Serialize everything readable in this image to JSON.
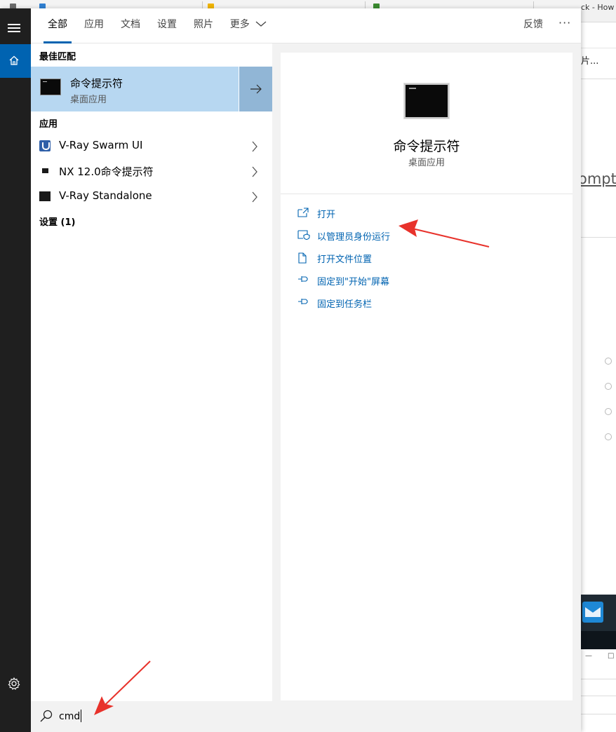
{
  "background_window": {
    "tab_title_fragment": "ck - How t",
    "toolbar_fragment": "片...",
    "text_fragment": "ompt",
    "window_controls": [
      "—",
      "□"
    ]
  },
  "tabs": [
    {
      "label": "全部",
      "active": true
    },
    {
      "label": "应用",
      "active": false
    },
    {
      "label": "文档",
      "active": false
    },
    {
      "label": "设置",
      "active": false
    },
    {
      "label": "照片",
      "active": false
    },
    {
      "label": "更多",
      "active": false,
      "dropdown": true
    }
  ],
  "header": {
    "feedback_label": "反馈",
    "more_label": "···"
  },
  "results": {
    "best_match_heading": "最佳匹配",
    "best_match": {
      "title": "命令提示符",
      "subtitle": "桌面应用",
      "icon": "command-prompt-icon"
    },
    "apps_heading": "应用",
    "apps": [
      {
        "name": "V-Ray Swarm UI",
        "icon": "vray-swarm-icon"
      },
      {
        "name": "NX 12.0命令提示符",
        "icon": "nx-command-prompt-icon"
      },
      {
        "name": "V-Ray Standalone",
        "icon": "vray-standalone-icon"
      }
    ],
    "settings_heading": "设置 (1)"
  },
  "details": {
    "title": "命令提示符",
    "subtitle": "桌面应用",
    "actions": [
      {
        "label": "打开",
        "icon": "open-icon"
      },
      {
        "label": "以管理员身份运行",
        "icon": "run-as-admin-icon"
      },
      {
        "label": "打开文件位置",
        "icon": "file-location-icon"
      },
      {
        "label": "固定到\"开始\"屏幕",
        "icon": "pin-icon"
      },
      {
        "label": "固定到任务栏",
        "icon": "pin-icon"
      }
    ]
  },
  "search": {
    "query": "cmd"
  },
  "colors": {
    "accent": "#0063b1",
    "selection": "#b7d7f1",
    "annotation": "#e8322b",
    "rail": "#1f1f1f"
  }
}
